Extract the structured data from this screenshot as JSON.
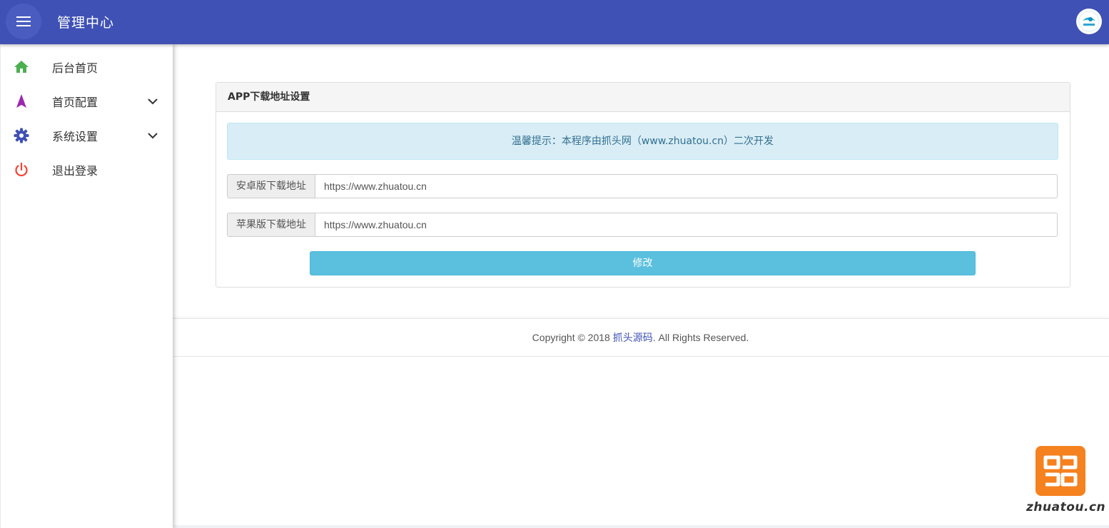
{
  "header": {
    "title": "管理中心",
    "menu_icon": "hamburger-menu-icon",
    "avatar_icon": "brand-logo-avatar-icon",
    "bg_color": "#3f51b5"
  },
  "sidebar": {
    "items": [
      {
        "label": "后台首页",
        "icon": "home-icon",
        "icon_color": "#4caf50",
        "expandable": false
      },
      {
        "label": "首页配置",
        "icon": "navigation-arrow-icon",
        "icon_color": "#9c27b0",
        "expandable": true
      },
      {
        "label": "系统设置",
        "icon": "gear-icon",
        "icon_color": "#3f51b5",
        "expandable": true
      },
      {
        "label": "退出登录",
        "icon": "power-icon",
        "icon_color": "#f44336",
        "expandable": false
      }
    ]
  },
  "panel": {
    "title": "APP下载地址设置",
    "alert": "温馨提示：本程序由抓头网（www.zhuatou.cn）二次开发",
    "fields": [
      {
        "label": "安卓版下载地址",
        "value": "https://www.zhuatou.cn"
      },
      {
        "label": "苹果版下载地址",
        "value": "https://www.zhuatou.cn"
      }
    ],
    "submit_label": "修改"
  },
  "footer": {
    "prefix": "Copyright © 2018 ",
    "link": "抓头源码",
    "suffix": ". All Rights Reserved."
  },
  "watermark": {
    "text": "zhuatou.cn",
    "logo_color": "#f5811f"
  }
}
